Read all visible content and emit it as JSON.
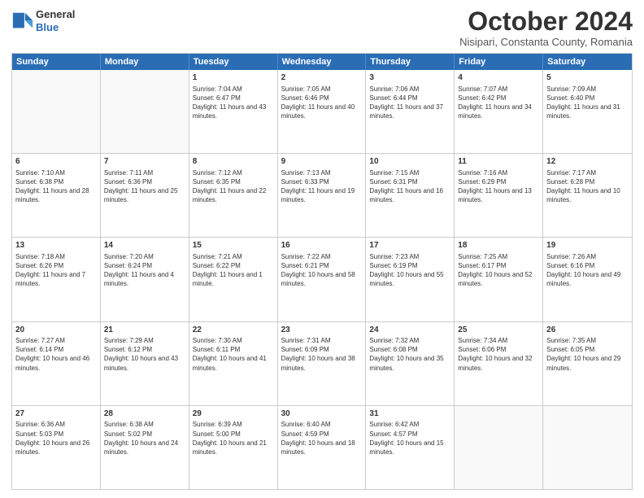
{
  "header": {
    "logo_line1": "General",
    "logo_line2": "Blue",
    "month": "October 2024",
    "location": "Nisipari, Constanta County, Romania"
  },
  "days_of_week": [
    "Sunday",
    "Monday",
    "Tuesday",
    "Wednesday",
    "Thursday",
    "Friday",
    "Saturday"
  ],
  "weeks": [
    [
      {
        "day": "",
        "info": ""
      },
      {
        "day": "",
        "info": ""
      },
      {
        "day": "1",
        "info": "Sunrise: 7:04 AM\nSunset: 6:47 PM\nDaylight: 11 hours and 43 minutes."
      },
      {
        "day": "2",
        "info": "Sunrise: 7:05 AM\nSunset: 6:46 PM\nDaylight: 11 hours and 40 minutes."
      },
      {
        "day": "3",
        "info": "Sunrise: 7:06 AM\nSunset: 6:44 PM\nDaylight: 11 hours and 37 minutes."
      },
      {
        "day": "4",
        "info": "Sunrise: 7:07 AM\nSunset: 6:42 PM\nDaylight: 11 hours and 34 minutes."
      },
      {
        "day": "5",
        "info": "Sunrise: 7:09 AM\nSunset: 6:40 PM\nDaylight: 11 hours and 31 minutes."
      }
    ],
    [
      {
        "day": "6",
        "info": "Sunrise: 7:10 AM\nSunset: 6:38 PM\nDaylight: 11 hours and 28 minutes."
      },
      {
        "day": "7",
        "info": "Sunrise: 7:11 AM\nSunset: 6:36 PM\nDaylight: 11 hours and 25 minutes."
      },
      {
        "day": "8",
        "info": "Sunrise: 7:12 AM\nSunset: 6:35 PM\nDaylight: 11 hours and 22 minutes."
      },
      {
        "day": "9",
        "info": "Sunrise: 7:13 AM\nSunset: 6:33 PM\nDaylight: 11 hours and 19 minutes."
      },
      {
        "day": "10",
        "info": "Sunrise: 7:15 AM\nSunset: 6:31 PM\nDaylight: 11 hours and 16 minutes."
      },
      {
        "day": "11",
        "info": "Sunrise: 7:16 AM\nSunset: 6:29 PM\nDaylight: 11 hours and 13 minutes."
      },
      {
        "day": "12",
        "info": "Sunrise: 7:17 AM\nSunset: 6:28 PM\nDaylight: 11 hours and 10 minutes."
      }
    ],
    [
      {
        "day": "13",
        "info": "Sunrise: 7:18 AM\nSunset: 6:26 PM\nDaylight: 11 hours and 7 minutes."
      },
      {
        "day": "14",
        "info": "Sunrise: 7:20 AM\nSunset: 6:24 PM\nDaylight: 11 hours and 4 minutes."
      },
      {
        "day": "15",
        "info": "Sunrise: 7:21 AM\nSunset: 6:22 PM\nDaylight: 11 hours and 1 minute."
      },
      {
        "day": "16",
        "info": "Sunrise: 7:22 AM\nSunset: 6:21 PM\nDaylight: 10 hours and 58 minutes."
      },
      {
        "day": "17",
        "info": "Sunrise: 7:23 AM\nSunset: 6:19 PM\nDaylight: 10 hours and 55 minutes."
      },
      {
        "day": "18",
        "info": "Sunrise: 7:25 AM\nSunset: 6:17 PM\nDaylight: 10 hours and 52 minutes."
      },
      {
        "day": "19",
        "info": "Sunrise: 7:26 AM\nSunset: 6:16 PM\nDaylight: 10 hours and 49 minutes."
      }
    ],
    [
      {
        "day": "20",
        "info": "Sunrise: 7:27 AM\nSunset: 6:14 PM\nDaylight: 10 hours and 46 minutes."
      },
      {
        "day": "21",
        "info": "Sunrise: 7:29 AM\nSunset: 6:12 PM\nDaylight: 10 hours and 43 minutes."
      },
      {
        "day": "22",
        "info": "Sunrise: 7:30 AM\nSunset: 6:11 PM\nDaylight: 10 hours and 41 minutes."
      },
      {
        "day": "23",
        "info": "Sunrise: 7:31 AM\nSunset: 6:09 PM\nDaylight: 10 hours and 38 minutes."
      },
      {
        "day": "24",
        "info": "Sunrise: 7:32 AM\nSunset: 6:08 PM\nDaylight: 10 hours and 35 minutes."
      },
      {
        "day": "25",
        "info": "Sunrise: 7:34 AM\nSunset: 6:06 PM\nDaylight: 10 hours and 32 minutes."
      },
      {
        "day": "26",
        "info": "Sunrise: 7:35 AM\nSunset: 6:05 PM\nDaylight: 10 hours and 29 minutes."
      }
    ],
    [
      {
        "day": "27",
        "info": "Sunrise: 6:36 AM\nSunset: 5:03 PM\nDaylight: 10 hours and 26 minutes."
      },
      {
        "day": "28",
        "info": "Sunrise: 6:38 AM\nSunset: 5:02 PM\nDaylight: 10 hours and 24 minutes."
      },
      {
        "day": "29",
        "info": "Sunrise: 6:39 AM\nSunset: 5:00 PM\nDaylight: 10 hours and 21 minutes."
      },
      {
        "day": "30",
        "info": "Sunrise: 6:40 AM\nSunset: 4:59 PM\nDaylight: 10 hours and 18 minutes."
      },
      {
        "day": "31",
        "info": "Sunrise: 6:42 AM\nSunset: 4:57 PM\nDaylight: 10 hours and 15 minutes."
      },
      {
        "day": "",
        "info": ""
      },
      {
        "day": "",
        "info": ""
      }
    ]
  ]
}
